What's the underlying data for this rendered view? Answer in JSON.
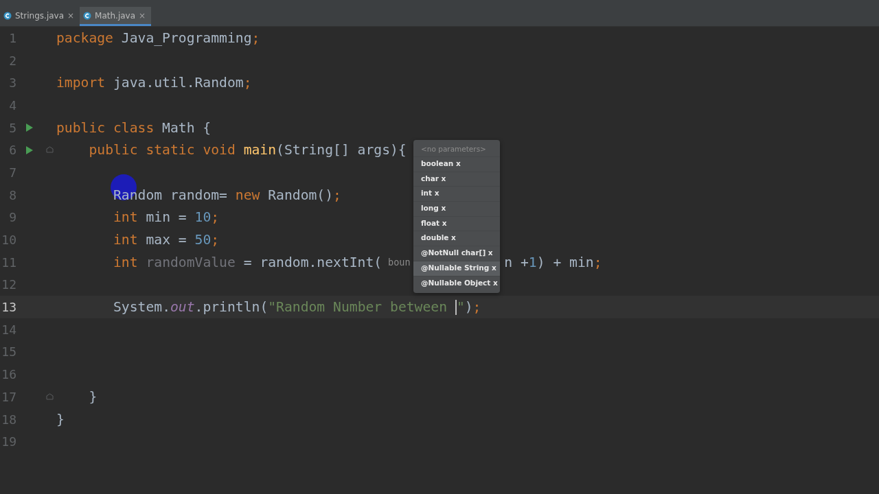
{
  "tabs": [
    {
      "label": "Strings.java",
      "close": "×",
      "selected": false
    },
    {
      "label": "Math.java",
      "close": "×",
      "selected": true
    }
  ],
  "editor": {
    "lines": [
      {
        "number": "1",
        "kind": "top",
        "tokens": [
          {
            "kind": "keyword",
            "text": "package"
          },
          {
            "kind": "plain",
            "text": " Java_Programming"
          },
          {
            "kind": "keyword",
            "text": ";"
          }
        ]
      },
      {
        "number": "2",
        "kind": "top"
      },
      {
        "number": "3",
        "kind": "top",
        "tokens": [
          {
            "kind": "keyword",
            "text": "import"
          },
          {
            "kind": "plain",
            "text": " java.util.Random"
          },
          {
            "kind": "keyword",
            "text": ";"
          }
        ]
      },
      {
        "number": "4",
        "kind": "top"
      },
      {
        "number": "5",
        "kind": "top",
        "run": true,
        "tokens": [
          {
            "kind": "keyword",
            "text": "public class"
          },
          {
            "kind": "plain",
            "text": " Math {"
          }
        ]
      },
      {
        "number": "6",
        "kind": "class",
        "run": true,
        "fold": true,
        "tokens": [
          {
            "kind": "keyword",
            "text": "public static void"
          },
          {
            "kind": "method",
            "text": " main"
          },
          {
            "kind": "plain",
            "text": "(String[] args){"
          }
        ]
      },
      {
        "number": "7",
        "kind": "top"
      },
      {
        "number": "8",
        "kind": "method",
        "click": true,
        "tokens": [
          {
            "kind": "plain",
            "text": "Random random= "
          },
          {
            "kind": "keyword",
            "text": "new"
          },
          {
            "kind": "plain",
            "text": " Random()"
          },
          {
            "kind": "keyword",
            "text": ";"
          }
        ]
      },
      {
        "number": "9",
        "kind": "method",
        "tokens": [
          {
            "kind": "keyword",
            "text": "int"
          },
          {
            "kind": "plain",
            "text": " min = "
          },
          {
            "kind": "number",
            "text": "10"
          },
          {
            "kind": "keyword",
            "text": ";"
          }
        ]
      },
      {
        "number": "10",
        "kind": "method",
        "tokens": [
          {
            "kind": "keyword",
            "text": "int"
          },
          {
            "kind": "plain",
            "text": " max = "
          },
          {
            "kind": "number",
            "text": "50"
          },
          {
            "kind": "keyword",
            "text": ";"
          }
        ]
      },
      {
        "number": "11",
        "kind": "method",
        "tokens": [
          {
            "kind": "keyword",
            "text": "int"
          },
          {
            "kind": "unused",
            "text": " randomValue"
          },
          {
            "kind": "plain",
            "text": " = random.nextInt( "
          },
          {
            "kind": "hint",
            "text": "boun"
          }
        ],
        "after_popup": [
          {
            "kind": "plain",
            "text": "n +"
          },
          {
            "kind": "number",
            "text": "1"
          },
          {
            "kind": "plain",
            "text": ") + min"
          },
          {
            "kind": "keyword",
            "text": ";"
          }
        ]
      },
      {
        "number": "12",
        "kind": "top"
      },
      {
        "number": "13",
        "kind": "method",
        "current": true,
        "tokens": [
          {
            "kind": "plain",
            "text": "System."
          },
          {
            "kind": "field",
            "text": "out"
          },
          {
            "kind": "plain",
            "text": ".println("
          },
          {
            "kind": "string",
            "text": "\"Random Number between "
          },
          {
            "kind": "caret"
          },
          {
            "kind": "string",
            "text": "\""
          },
          {
            "kind": "plain",
            "text": ")"
          },
          {
            "kind": "keyword",
            "text": ";"
          }
        ]
      },
      {
        "number": "14",
        "kind": "top"
      },
      {
        "number": "15",
        "kind": "top"
      },
      {
        "number": "16",
        "kind": "top"
      },
      {
        "number": "17",
        "kind": "class",
        "fold": true,
        "tokens": [
          {
            "kind": "plain",
            "text": "}"
          }
        ]
      },
      {
        "number": "18",
        "kind": "top",
        "tokens": [
          {
            "kind": "plain",
            "text": "}"
          }
        ]
      },
      {
        "number": "19",
        "kind": "top"
      }
    ]
  },
  "popup": {
    "header": "<no parameters>",
    "items": [
      {
        "label": "boolean x",
        "selected": false
      },
      {
        "label": "char x",
        "selected": false
      },
      {
        "label": "int x",
        "selected": false
      },
      {
        "label": "long x",
        "selected": false
      },
      {
        "label": "float x",
        "selected": false
      },
      {
        "label": "double x",
        "selected": false
      },
      {
        "label": "@NotNull char[] x",
        "selected": false
      },
      {
        "label": "@Nullable String x",
        "selected": true
      },
      {
        "label": "@Nullable Object x",
        "selected": false
      }
    ]
  }
}
